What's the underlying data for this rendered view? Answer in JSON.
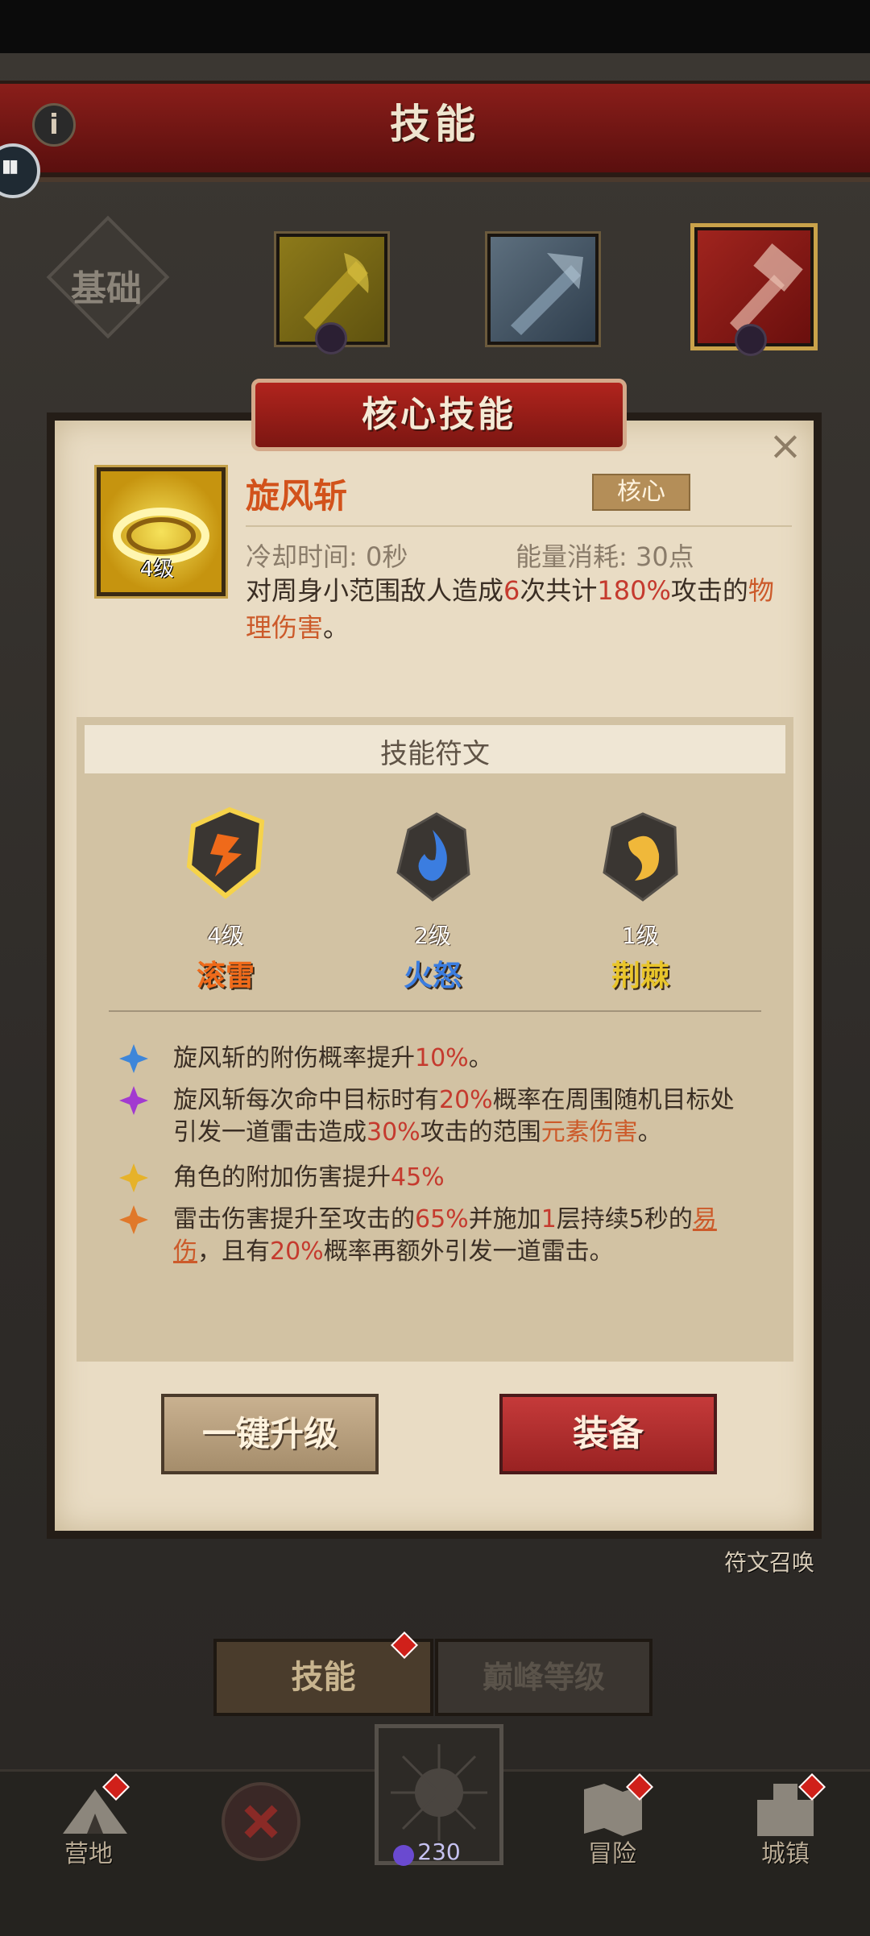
{
  "header": {
    "title": "技能"
  },
  "categories": {
    "basic_label": "基础"
  },
  "panel": {
    "banner_title": "核心技能",
    "skill": {
      "name": "旋风斩",
      "level": "4级",
      "tag": "核心",
      "cooldown": "冷却时间: 0秒",
      "energy": "能量消耗: 30点",
      "desc_parts": [
        "对周身小范围敌人造成",
        "6",
        "次共计",
        "180%",
        "攻击的",
        "物理伤害",
        "。"
      ]
    },
    "runes": {
      "title": "技能符文",
      "items": [
        {
          "level": "4级",
          "name": "滚雷",
          "color": "#ef6a1a"
        },
        {
          "level": "2级",
          "name": "火怒",
          "color": "#3b7de0"
        },
        {
          "level": "1级",
          "name": "荆棘",
          "color": "#e9c52a"
        }
      ]
    },
    "bonuses": [
      {
        "star_color": "#3e86d9",
        "parts": [
          "旋风斩的附伤概率提升",
          "10%",
          "。"
        ]
      },
      {
        "star_color": "#a23ad0",
        "parts": [
          "旋风斩每次命中目标时有",
          "20%",
          "概率在周围随机目标处引发一道雷击造成",
          "30%",
          "攻击的范围",
          "元素伤害",
          "。"
        ]
      },
      {
        "star_color": "#e6b22a",
        "parts": [
          "角色的附加伤害提升",
          "45%"
        ]
      },
      {
        "star_color": "#e0782a",
        "parts": [
          "雷击伤害提升至攻击的",
          "65%",
          "并施加",
          "1",
          "层持续5秒的",
          "易伤",
          "，且有",
          "20%",
          "概率再额外引发一道雷击。"
        ]
      }
    ],
    "buttons": {
      "upgrade": "一键升级",
      "equip": "装备"
    }
  },
  "rune_summon": "符文召唤",
  "bottom_tabs": {
    "skill": "技能",
    "peak": "巅峰等级"
  },
  "navbar": {
    "camp": "营地",
    "adventure": "冒险",
    "town": "城镇",
    "currency": "230"
  }
}
